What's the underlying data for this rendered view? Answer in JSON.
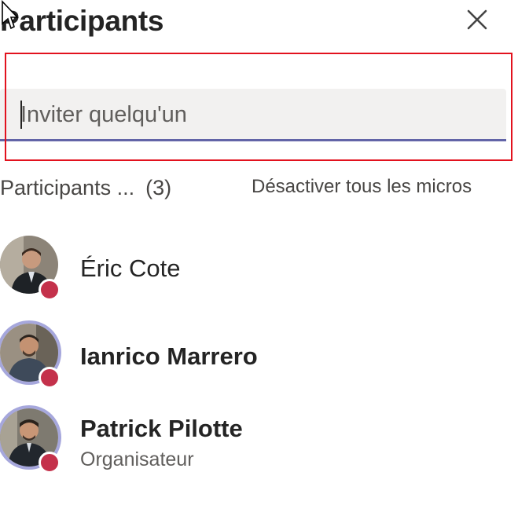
{
  "panel": {
    "title": "Participants",
    "close_icon": "close-icon"
  },
  "search": {
    "placeholder": "Inviter quelqu'un",
    "value": ""
  },
  "section": {
    "label": "Participants ...",
    "count": "(3)",
    "mute_all_label": "Désactiver tous les micros"
  },
  "participants": [
    {
      "name": "Éric Cote",
      "role": "",
      "status": "busy"
    },
    {
      "name": "Ianrico Marrero",
      "role": "",
      "status": "busy"
    },
    {
      "name": "Patrick Pilotte",
      "role": "Organisateur",
      "status": "busy"
    }
  ],
  "colors": {
    "accent": "#6264a7",
    "highlight_border": "#e2121e",
    "status_busy": "#c4314b",
    "speaking_ring": "#a6a7dc"
  }
}
